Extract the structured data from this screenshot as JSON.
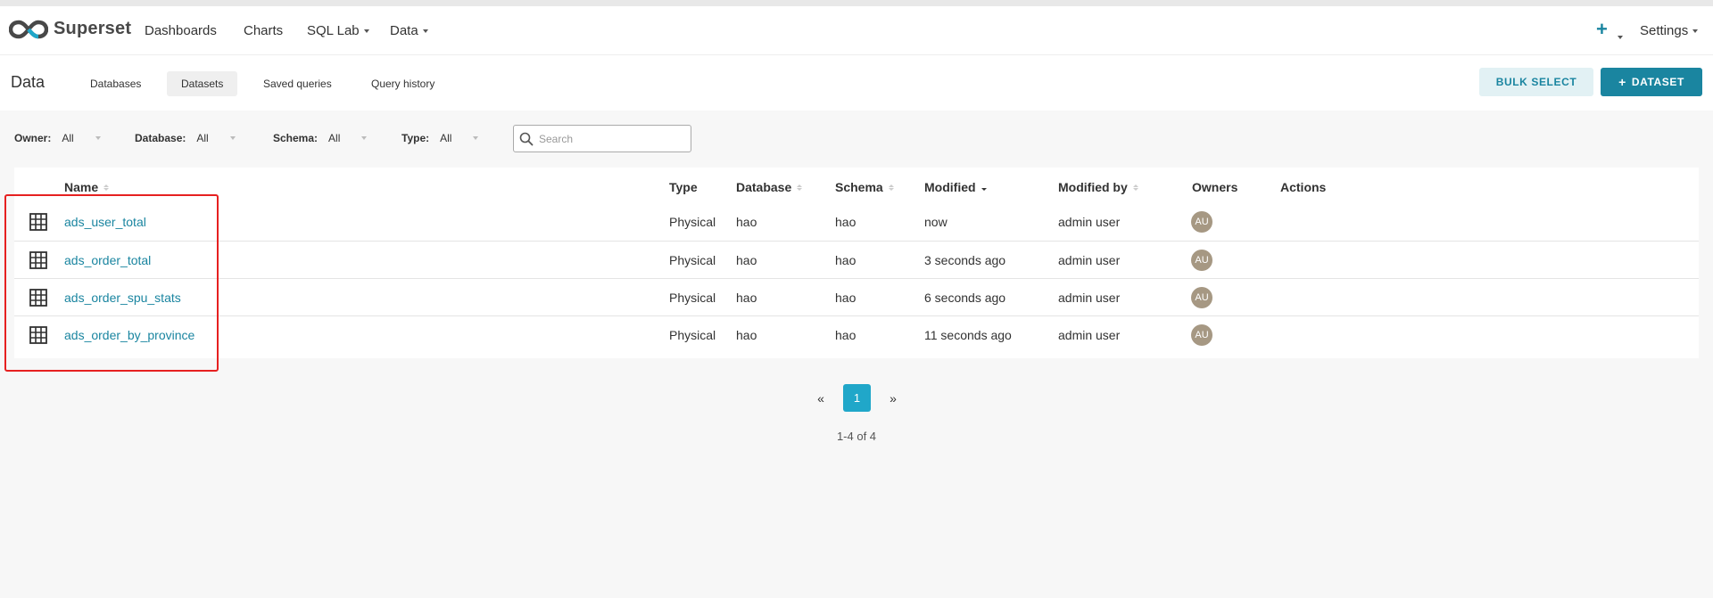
{
  "brand": {
    "name": "Superset"
  },
  "nav": {
    "dashboards": "Dashboards",
    "charts": "Charts",
    "sql_lab": "SQL Lab",
    "data": "Data",
    "settings": "Settings"
  },
  "subheader": {
    "title": "Data",
    "tabs": [
      {
        "label": "Databases"
      },
      {
        "label": "Datasets"
      },
      {
        "label": "Saved queries"
      },
      {
        "label": "Query history"
      }
    ],
    "bulk_select": "BULK SELECT",
    "add_dataset": "DATASET"
  },
  "filters": {
    "owner": {
      "label": "Owner:",
      "value": "All"
    },
    "database": {
      "label": "Database:",
      "value": "All"
    },
    "schema": {
      "label": "Schema:",
      "value": "All"
    },
    "type": {
      "label": "Type:",
      "value": "All"
    },
    "search_placeholder": "Search"
  },
  "table": {
    "headers": {
      "name": "Name",
      "type": "Type",
      "database": "Database",
      "schema": "Schema",
      "modified": "Modified",
      "modified_by": "Modified by",
      "owners": "Owners",
      "actions": "Actions"
    },
    "rows": [
      {
        "name": "ads_user_total",
        "type": "Physical",
        "database": "hao",
        "schema": "hao",
        "modified": "now",
        "modified_by": "admin user",
        "owner": "AU"
      },
      {
        "name": "ads_order_total",
        "type": "Physical",
        "database": "hao",
        "schema": "hao",
        "modified": "3 seconds ago",
        "modified_by": "admin user",
        "owner": "AU"
      },
      {
        "name": "ads_order_spu_stats",
        "type": "Physical",
        "database": "hao",
        "schema": "hao",
        "modified": "6 seconds ago",
        "modified_by": "admin user",
        "owner": "AU"
      },
      {
        "name": "ads_order_by_province",
        "type": "Physical",
        "database": "hao",
        "schema": "hao",
        "modified": "11 seconds ago",
        "modified_by": "admin user",
        "owner": "AU"
      }
    ]
  },
  "pagination": {
    "prev": "«",
    "current": "1",
    "next": "»",
    "info": "1-4 of 4"
  },
  "colors": {
    "accent": "#1a85a0",
    "page_active": "#20a7c9",
    "highlight": "#e62020",
    "avatar": "#a69883"
  }
}
